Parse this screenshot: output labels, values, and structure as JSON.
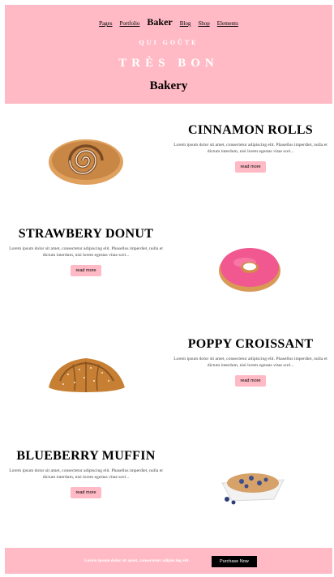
{
  "header": {
    "nav": [
      "Pages",
      "Portfolio",
      "Baker",
      "Blog",
      "Shop",
      "Elements"
    ],
    "sub": "QUI GOÛTE",
    "tagline": "TRÈS BON",
    "title": "Bakery"
  },
  "items": [
    {
      "title": "CINNAMON ROLLS",
      "desc": "Lorem ipsum dolor sit amet, consectetur adipiscing elit. Phasellus imperdiet, nulla et dictum interdum, nisi lorem egestas vitae scel...",
      "button": "read more"
    },
    {
      "title": "STRAWBERY DONUT",
      "desc": "Lorem ipsum dolor sit amet, consectetur adipiscing elit. Phasellus imperdiet, nulla et dictum interdum, nisi lorem egestas vitae scel...",
      "button": "read more"
    },
    {
      "title": "POPPY CROISSANT",
      "desc": "Lorem ipsum dolor sit amet, consectetur adipiscing elit. Phasellus imperdiet, nulla et dictum interdum, nisi lorem egestas vitae scel...",
      "button": "read more"
    },
    {
      "title": "BLUEBERRY MUFFIN",
      "desc": "Lorem ipsum dolor sit amet, consectetur adipiscing elit. Phasellus imperdiet, nulla et dictum interdum, nisi lorem egestas vitae scel...",
      "button": "read more"
    }
  ],
  "footer": {
    "text": "Lorem ipsum dolor sit amet, consectetur adipiscing elit.",
    "button": "Purchase Now"
  },
  "colors": {
    "accent": "#ffbac5"
  }
}
